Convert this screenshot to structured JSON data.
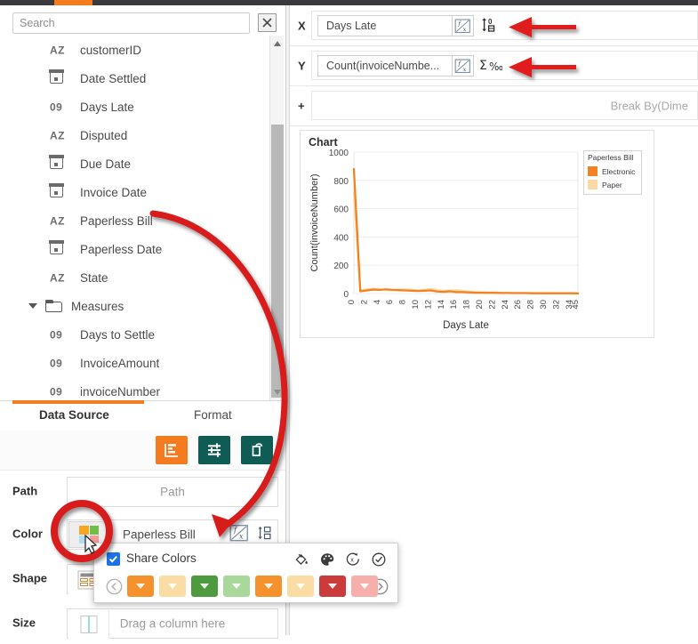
{
  "topbar": {
    "tab_accent": "#F47B20",
    "bar_color": "#3a3a3c"
  },
  "search": {
    "placeholder": "Search",
    "value": "",
    "clear_icon": "close-x-icon"
  },
  "field_list": {
    "items": [
      {
        "icon": "az-text-icon",
        "type": "AZ",
        "label": "customerID"
      },
      {
        "icon": "calendar-icon",
        "type": "DATE",
        "label": "Date Settled"
      },
      {
        "icon": "number-icon",
        "type": "09",
        "label": "Days Late"
      },
      {
        "icon": "az-text-icon",
        "type": "AZ",
        "label": "Disputed"
      },
      {
        "icon": "calendar-icon",
        "type": "DATE",
        "label": "Due Date"
      },
      {
        "icon": "calendar-icon",
        "type": "DATE",
        "label": "Invoice Date"
      },
      {
        "icon": "az-text-icon",
        "type": "AZ",
        "label": "Paperless Bill"
      },
      {
        "icon": "calendar-icon",
        "type": "DATE",
        "label": "Paperless Date"
      },
      {
        "icon": "az-text-icon",
        "type": "AZ",
        "label": "State"
      }
    ],
    "folder": {
      "icon": "folder-icon",
      "caret": "chevron-down-icon",
      "label": "Measures",
      "expanded": true
    },
    "measures": [
      {
        "icon": "number-icon",
        "type": "09",
        "label": "Days to Settle"
      },
      {
        "icon": "number-icon",
        "type": "09",
        "label": "InvoiceAmount"
      },
      {
        "icon": "number-icon",
        "type": "09",
        "label": "invoiceNumber"
      }
    ],
    "scrollbar": {
      "up_icon": "caret-up-icon",
      "down_icon": "caret-down-icon"
    }
  },
  "tabs": {
    "active": "Data Source",
    "items": [
      {
        "label": "Data Source",
        "active": true
      },
      {
        "label": "Format",
        "active": false
      }
    ]
  },
  "mark_toolbar": {
    "buttons": [
      {
        "name": "chart-type-button",
        "icon": "bar-chart-icon",
        "active": true,
        "color": "#F47B20"
      },
      {
        "name": "filter-button",
        "icon": "filter-icon",
        "active": false,
        "color": "#0e5c53"
      },
      {
        "name": "reset-layout-button",
        "icon": "rotate-page-icon",
        "active": false,
        "color": "#0e5c53"
      }
    ]
  },
  "shelves": {
    "path": {
      "label": "Path",
      "placeholder": "Path",
      "value": ""
    },
    "color": {
      "label": "Color",
      "value": "Paperless Bill",
      "swatch_icon": "color-swatch-icon",
      "fx_icon": "fx-icon",
      "sort_icon": "sort-icon",
      "swatch_colors": [
        "#F5A623",
        "#6FBF44",
        "#AEDDF5",
        "#F59999"
      ]
    },
    "shape": {
      "label": "Shape",
      "placeholder": "",
      "thumb_icon": "shape-list-icon"
    },
    "size": {
      "label": "Size",
      "placeholder": "Drag a column here",
      "thumb_icon": "size-bar-icon"
    }
  },
  "encodings": {
    "x": {
      "letter": "X",
      "value": "Days Late",
      "fx_icon": "fx-icon",
      "sort_icon": "sort-ascending-icon"
    },
    "y": {
      "letter": "Y",
      "value": "Count(invoiceNumbe...",
      "fx_icon": "fx-icon",
      "sort_icon": "sigma-percent-icon"
    },
    "add": {
      "letter": "+",
      "placeholder": "Break By(Dime"
    }
  },
  "chart_data": {
    "type": "line",
    "title": "Chart",
    "xlabel": "Days Late",
    "ylabel": "Count(invoiceNumber)",
    "xlim": [
      0,
      45
    ],
    "ylim": [
      0,
      1000
    ],
    "yticks": [
      0,
      200,
      400,
      600,
      800,
      1000
    ],
    "xticks": [
      "0",
      "2",
      "4",
      "6",
      "8",
      "10",
      "12",
      "14",
      "16",
      "18",
      "20",
      "22",
      "24",
      "26",
      "28",
      "30",
      "32",
      "34",
      "45"
    ],
    "grid": true,
    "legend": {
      "title": "Paperless Bill",
      "position": "right"
    },
    "series": [
      {
        "name": "Electronic",
        "color": "#F58220",
        "x": [
          0,
          1,
          2,
          3,
          4,
          5,
          6,
          7,
          8,
          9,
          10,
          11,
          12,
          13,
          14,
          15,
          16,
          17,
          18,
          19,
          20,
          21,
          22,
          23,
          24,
          25,
          26,
          27,
          28,
          29,
          30,
          31,
          32,
          33,
          34,
          45
        ],
        "values": [
          880,
          16,
          22,
          28,
          26,
          30,
          26,
          24,
          22,
          20,
          18,
          20,
          22,
          14,
          12,
          16,
          10,
          10,
          8,
          6,
          6,
          5,
          5,
          4,
          4,
          3,
          3,
          3,
          2,
          2,
          2,
          2,
          2,
          2,
          2,
          1
        ]
      },
      {
        "name": "Paper",
        "color": "#FBD9A5",
        "x": [
          0,
          1,
          2,
          3,
          4,
          5,
          6,
          7,
          8,
          9,
          10,
          11,
          12,
          13,
          14,
          15,
          16,
          17,
          18,
          19,
          20,
          21,
          22,
          23,
          24,
          25,
          26,
          27,
          28,
          29,
          30,
          31,
          32,
          33,
          34,
          45
        ],
        "values": [
          715,
          24,
          30,
          34,
          30,
          26,
          24,
          28,
          30,
          26,
          22,
          26,
          34,
          24,
          18,
          22,
          24,
          18,
          14,
          10,
          8,
          7,
          6,
          5,
          5,
          4,
          4,
          3,
          3,
          3,
          2,
          2,
          2,
          2,
          2,
          1
        ]
      }
    ]
  },
  "color_popup": {
    "share_colors_label": "Share Colors",
    "share_colors_checked": true,
    "check_icon": "checkmark-icon",
    "tools": [
      {
        "name": "paint-bucket-icon",
        "label": "Fill"
      },
      {
        "name": "palette-icon",
        "label": "Palette"
      },
      {
        "name": "reset-icon",
        "label": "Reset"
      },
      {
        "name": "confirm-icon",
        "label": "Apply"
      }
    ],
    "prev_icon": "chevron-left-circle-icon",
    "next_icon": "chevron-right-circle-icon",
    "swatches": [
      "#F5922E",
      "#FBDCA4",
      "#4E9A3F",
      "#A8D89A",
      "#F5922E",
      "#FBDCA4",
      "#CC3B3B",
      "#F7AFAC"
    ]
  },
  "annotations": {
    "arrow_color": "#E01B1B",
    "items": [
      {
        "name": "arrow-to-x-sort",
        "type": "straight-arrow"
      },
      {
        "name": "arrow-to-y-aggregate",
        "type": "straight-arrow"
      },
      {
        "name": "arrow-paperless-bill-to-color",
        "type": "curved-arrow"
      },
      {
        "name": "highlight-color-swatch",
        "type": "circle-highlight"
      }
    ]
  }
}
